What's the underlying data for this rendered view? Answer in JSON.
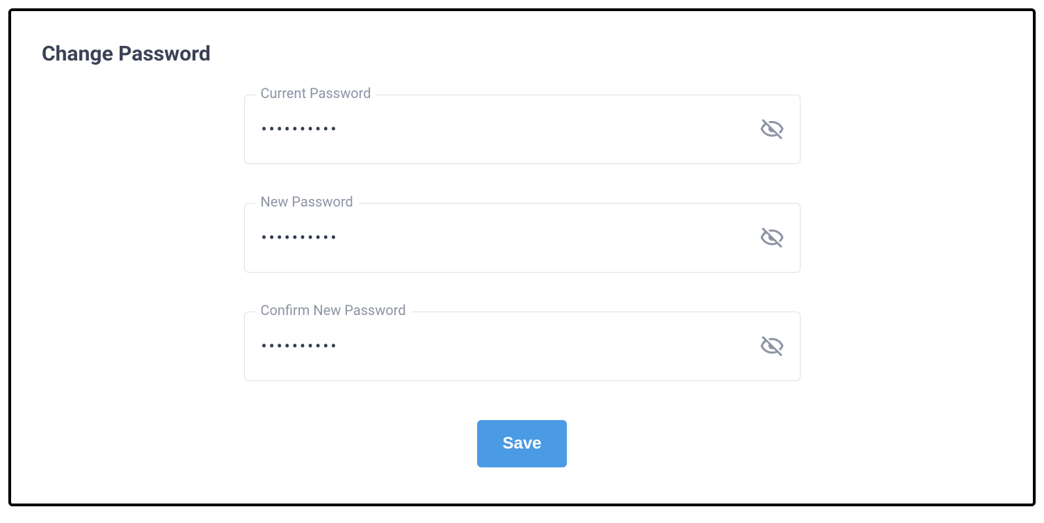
{
  "title": "Change Password",
  "fields": {
    "current": {
      "label": "Current Password",
      "value": "••••••••••"
    },
    "new": {
      "label": "New Password",
      "value": "••••••••••"
    },
    "confirm": {
      "label": "Confirm New Password",
      "value": "••••••••••"
    }
  },
  "save_label": "Save"
}
